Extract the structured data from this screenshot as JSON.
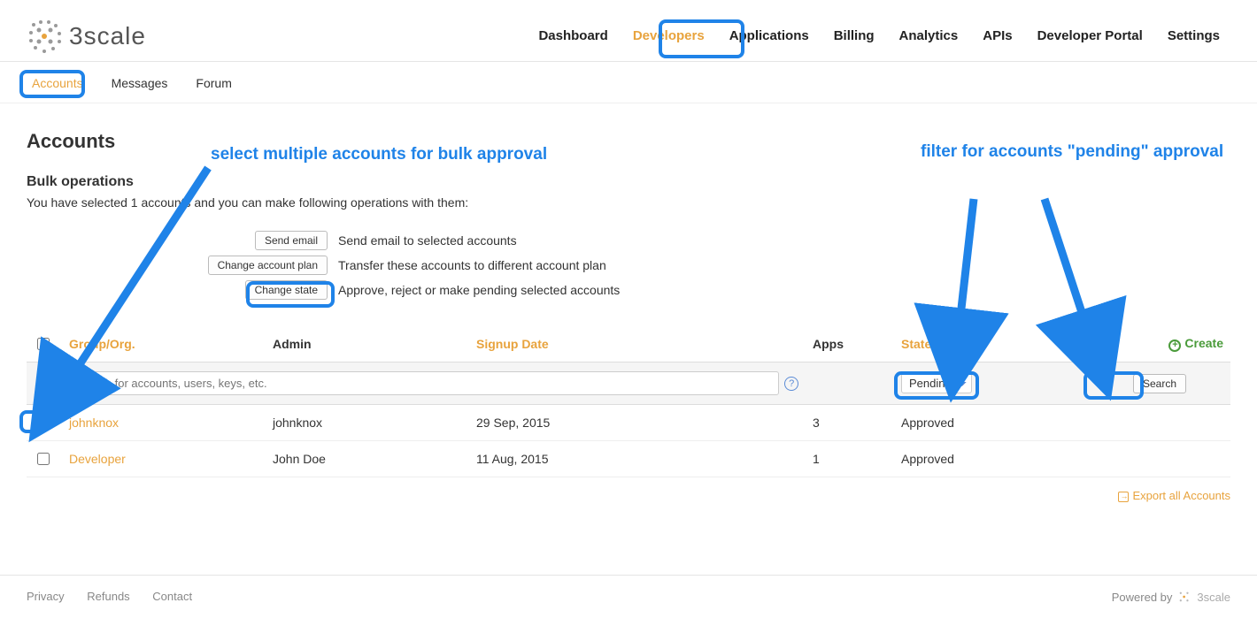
{
  "brand": {
    "name": "3scale"
  },
  "top_nav": {
    "items": [
      "Dashboard",
      "Developers",
      "Applications",
      "Billing",
      "Analytics",
      "APIs",
      "Developer Portal",
      "Settings"
    ],
    "active": "Developers"
  },
  "sub_nav": {
    "items": [
      "Accounts",
      "Messages",
      "Forum"
    ],
    "active": "Accounts"
  },
  "page": {
    "title": "Accounts",
    "bulk_title": "Bulk operations",
    "bulk_desc": "You have selected 1 accounts and you can make following operations with them:"
  },
  "bulk_ops": [
    {
      "button": "Send email",
      "desc": "Send email to selected accounts"
    },
    {
      "button": "Change account plan",
      "desc": "Transfer these accounts to different account plan"
    },
    {
      "button": "Change state",
      "desc": "Approve, reject or make pending selected accounts"
    }
  ],
  "table": {
    "headers": {
      "group": "Group/Org.",
      "admin": "Admin",
      "signup": "Signup Date",
      "apps": "Apps",
      "state": "State"
    },
    "create": "Create",
    "search_placeholder": "search for accounts, users, keys, etc.",
    "state_filter": "Pending",
    "search_button": "Search",
    "rows": [
      {
        "checked": true,
        "group": "johnknox",
        "admin": "johnknox",
        "signup": "29 Sep, 2015",
        "apps": "3",
        "state": "Approved"
      },
      {
        "checked": false,
        "group": "Developer",
        "admin": "John Doe",
        "signup": "11 Aug, 2015",
        "apps": "1",
        "state": "Approved"
      }
    ],
    "export": "Export all Accounts"
  },
  "footer": {
    "links": [
      "Privacy",
      "Refunds",
      "Contact"
    ],
    "powered": "Powered by",
    "powered_brand": "3scale"
  },
  "annotations": {
    "bulk": "select multiple accounts for bulk approval",
    "filter": "filter for accounts \"pending\" approval"
  }
}
